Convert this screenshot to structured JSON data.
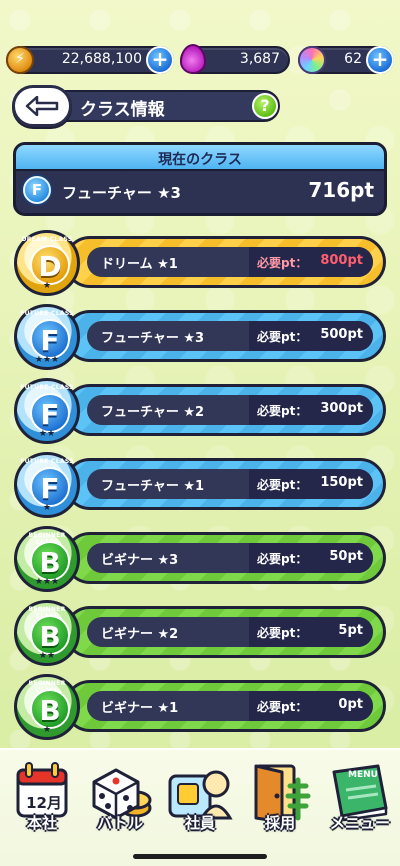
{
  "resources": {
    "coins": {
      "value": "22,688,100",
      "icon": "coin-icon"
    },
    "drops": {
      "value": "3,687",
      "icon": "purple-drop-icon"
    },
    "orbs": {
      "value": "62",
      "icon": "rainbow-orb-icon"
    },
    "plus_symbol": "+"
  },
  "header": {
    "title": "クラス情報",
    "help_symbol": "?"
  },
  "current_class": {
    "heading": "現在のクラス",
    "badge_letter": "F",
    "name": "フューチャー ★3",
    "points": "716pt"
  },
  "requirement_label": "必要pt：",
  "class_list": [
    {
      "letter": "D",
      "class_caption": "DREAM CLASS",
      "name": "ドリーム ★1",
      "required": "800pt",
      "stars": "★",
      "theme": "gold",
      "locked": true
    },
    {
      "letter": "F",
      "class_caption": "FUTURE CLASS",
      "name": "フューチャー ★3",
      "required": "500pt",
      "stars": "★★★",
      "theme": "blue"
    },
    {
      "letter": "F",
      "class_caption": "FUTURE CLASS",
      "name": "フューチャー ★2",
      "required": "300pt",
      "stars": "★★",
      "theme": "blue"
    },
    {
      "letter": "F",
      "class_caption": "FUTURE CLASS",
      "name": "フューチャー ★1",
      "required": "150pt",
      "stars": "★",
      "theme": "blue"
    },
    {
      "letter": "B",
      "class_caption": "BEGINNER CLASS",
      "name": "ビギナー ★3",
      "required": "50pt",
      "stars": "★★★",
      "theme": "green"
    },
    {
      "letter": "B",
      "class_caption": "BEGINNER CLASS",
      "name": "ビギナー ★2",
      "required": "5pt",
      "stars": "★★",
      "theme": "green"
    },
    {
      "letter": "B",
      "class_caption": "BEGINNER CLASS",
      "name": "ビギナー ★1",
      "required": "0pt",
      "stars": "★",
      "theme": "green"
    }
  ],
  "nav": {
    "calendar_text": "12月",
    "menu_tag": "MENU",
    "items": [
      {
        "label": "本社",
        "icon": "calendar-icon"
      },
      {
        "label": "バトル",
        "icon": "dice-icon"
      },
      {
        "label": "社員",
        "icon": "employee-card-icon"
      },
      {
        "label": "採用",
        "icon": "door-icon"
      },
      {
        "label": "メニュー",
        "icon": "menu-book-icon"
      }
    ]
  },
  "colors": {
    "accent_blue": "#4fb4f2",
    "dark_panel": "#2d3152",
    "locked_red": "#ff5f6d"
  }
}
